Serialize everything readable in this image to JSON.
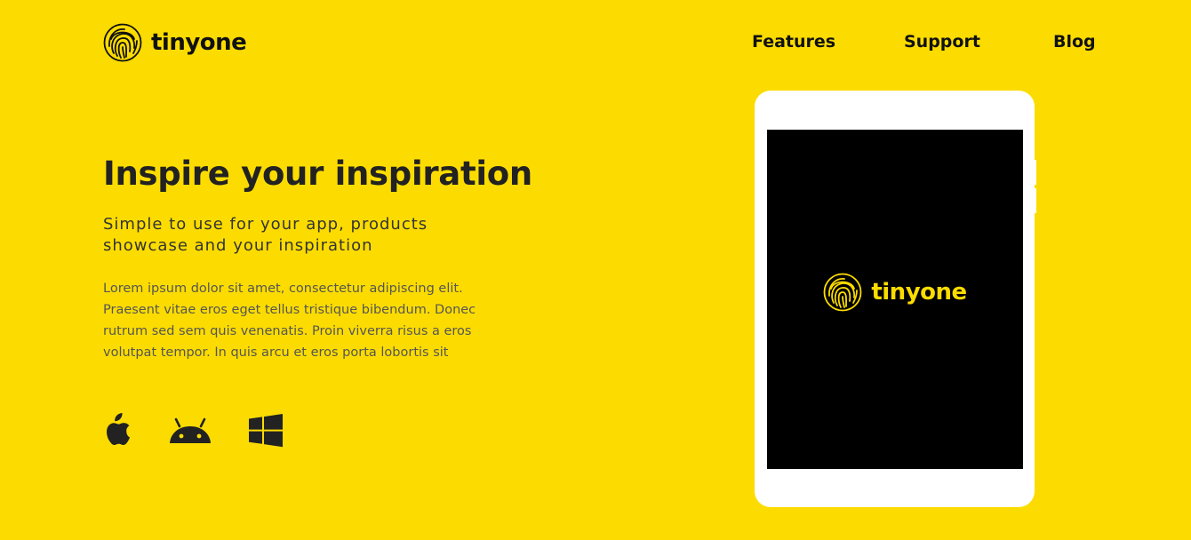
{
  "header": {
    "brand": "tinyone",
    "logo_icon": "fingerprint-icon",
    "nav": [
      {
        "label": "Features"
      },
      {
        "label": "Support"
      },
      {
        "label": "Blog"
      }
    ]
  },
  "hero": {
    "title": "Inspire your inspiration",
    "subtitle": "Simple to use for your app, products showcase and your inspiration",
    "body": "Lorem ipsum dolor sit amet, consectetur adipiscing elit. Praesent vitae eros eget tellus tristique bibendum. Donec rutrum sed sem quis venenatis. Proin viverra risus a eros volutpat tempor. In quis arcu et eros porta lobortis sit",
    "platforms": [
      {
        "icon": "apple-icon"
      },
      {
        "icon": "android-icon"
      },
      {
        "icon": "windows-icon"
      }
    ]
  },
  "device": {
    "type": "tablet",
    "screen_brand": "tinyone",
    "screen_logo_icon": "fingerprint-icon"
  },
  "colors": {
    "background": "#fcdc00",
    "text_dark": "#222222",
    "screen": "#000000",
    "accent": "#fcdc00"
  }
}
